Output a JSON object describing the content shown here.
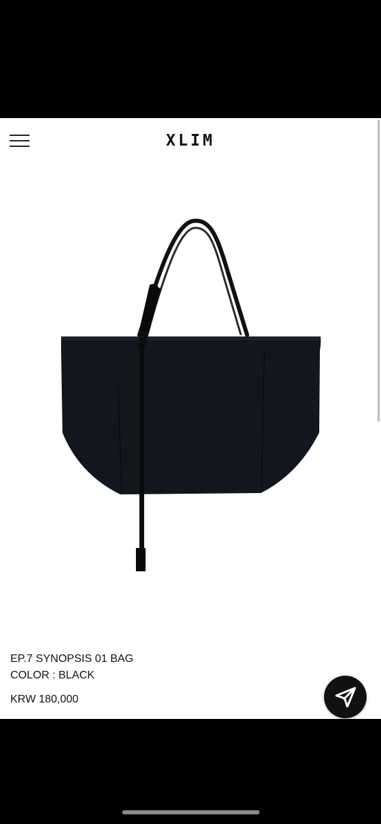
{
  "header": {
    "brand": "XLIM",
    "menu_icon": "hamburger-menu-icon"
  },
  "product": {
    "image_description_icon": "tote-bag-image",
    "name": "EP.7 SYNOPSIS 01 BAG",
    "color_line": "COLOR : BLACK",
    "price": "KRW 180,000"
  },
  "fab": {
    "icon": "send-arrow-icon"
  },
  "colors": {
    "background": "#ffffff",
    "text": "#111111",
    "bag": "#14161d",
    "fab": "#111111"
  }
}
